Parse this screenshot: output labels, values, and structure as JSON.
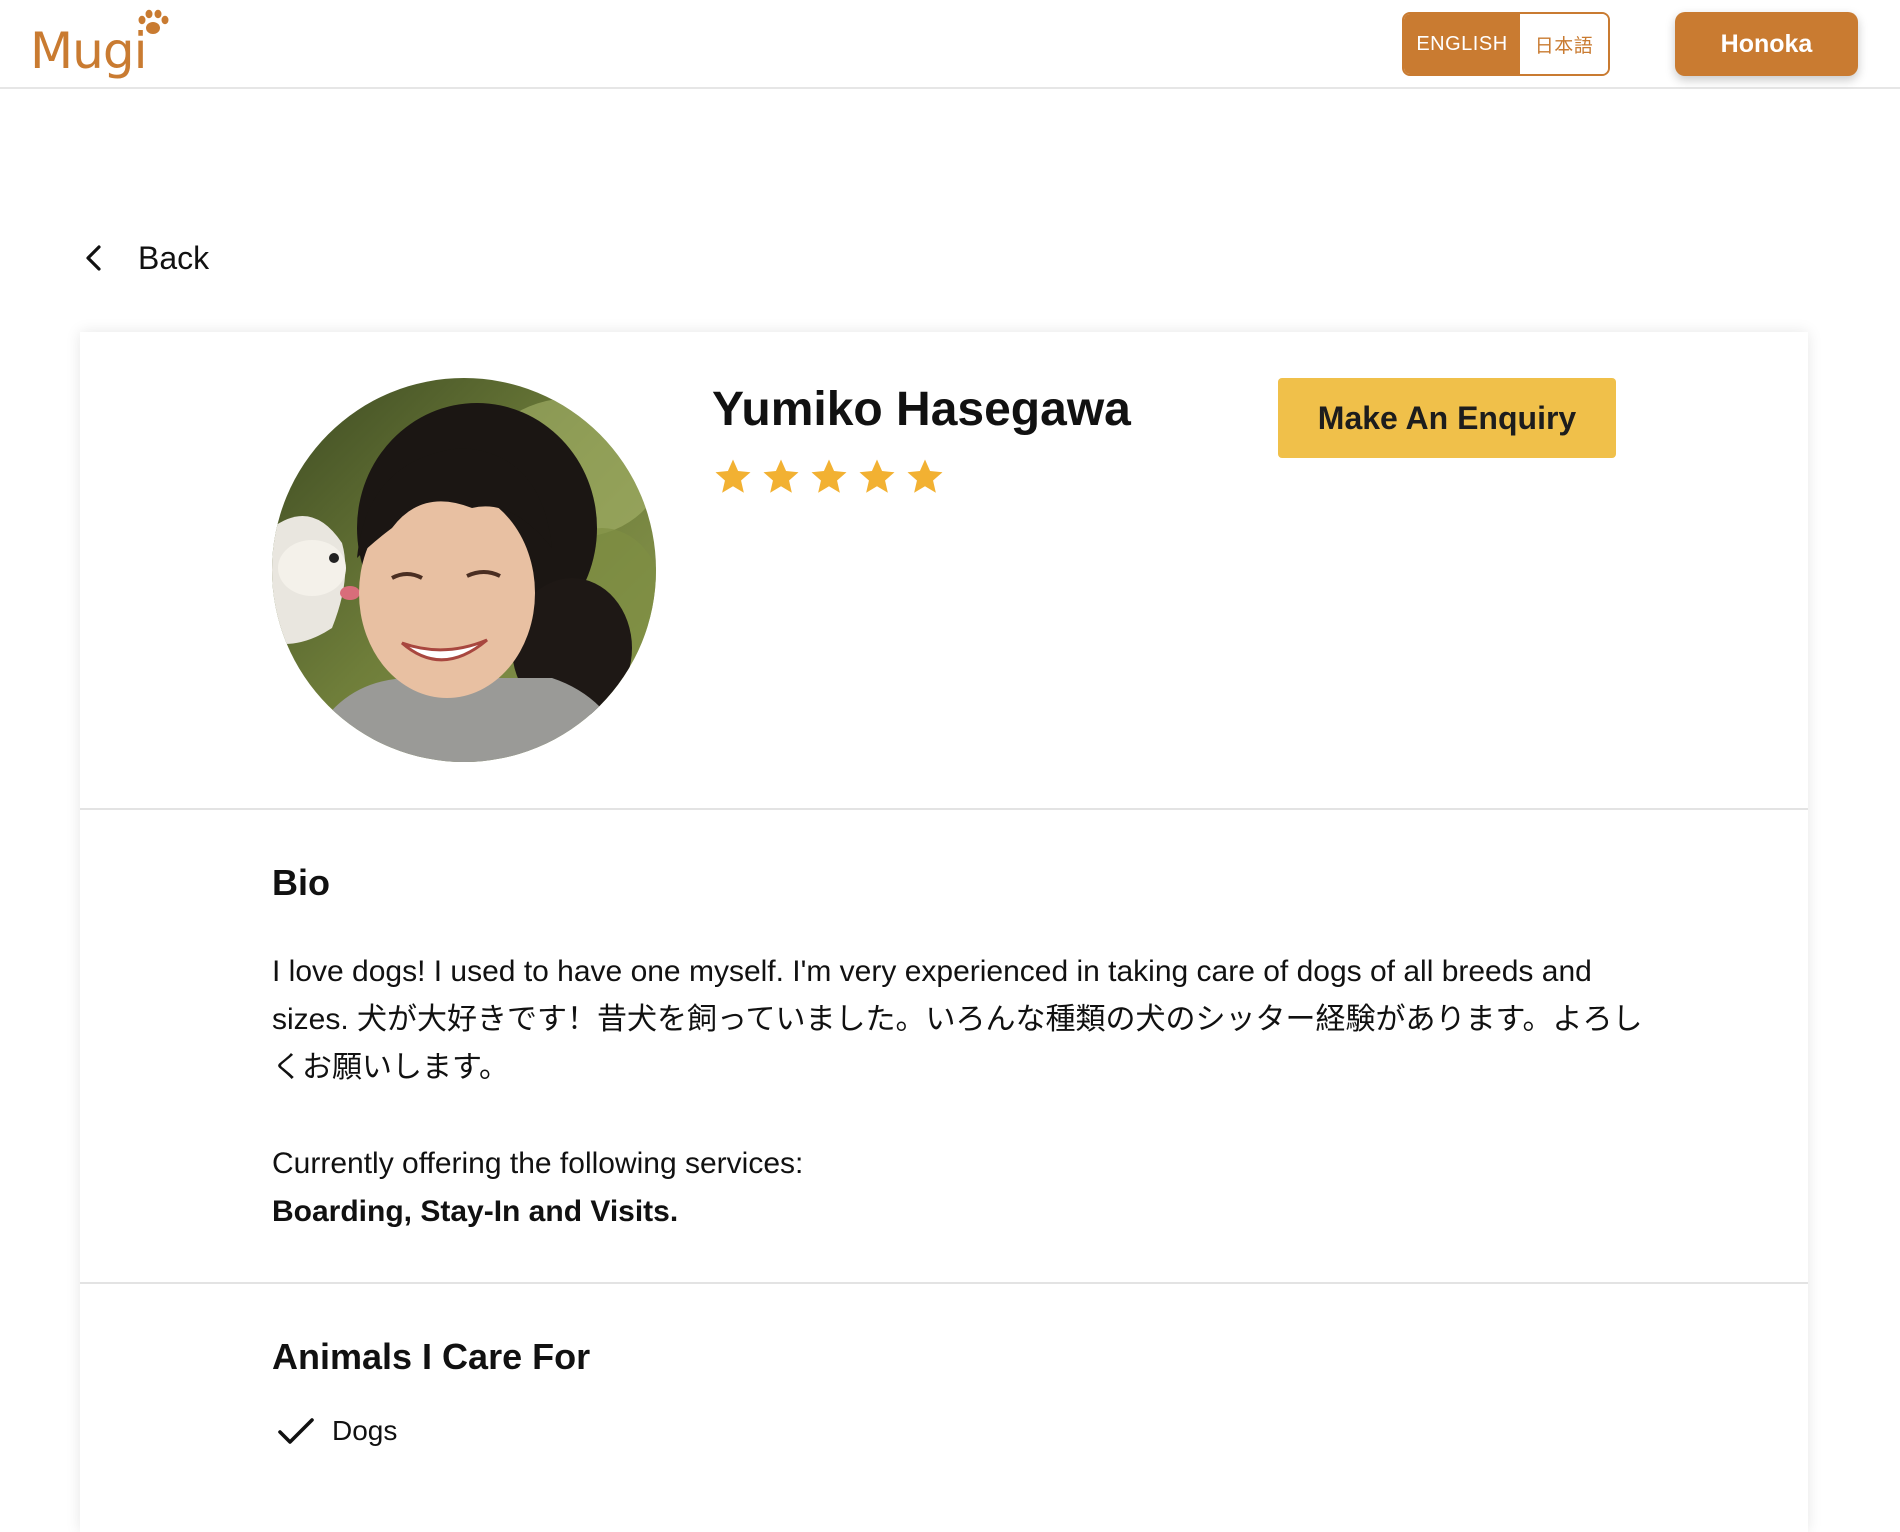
{
  "header": {
    "logo_text": "Mugi",
    "language": {
      "english_label": "ENGLISH",
      "japanese_label": "日本語",
      "selected": "ENGLISH"
    },
    "user_label": "Honoka"
  },
  "nav": {
    "back_label": "Back"
  },
  "profile": {
    "name": "Yumiko Hasegawa",
    "rating": 5,
    "rating_max": 5,
    "enquiry_label": "Make An Enquiry"
  },
  "bio": {
    "title": "Bio",
    "text": "I love dogs! I used to have one myself. I'm very experienced in taking care of dogs of all breeds and sizes. 犬が大好きです！昔犬を飼っていました。いろんな種類の犬のシッター経験があります。よろしくお願いします。",
    "services_label": "Currently offering the following services:",
    "services_value": "Boarding, Stay-In and Visits."
  },
  "animals": {
    "title": "Animals I Care For",
    "items": [
      "Dogs"
    ]
  },
  "colors": {
    "brand": "#c97b31",
    "accent": "#f0c04a",
    "star": "#f2b132"
  },
  "icons": {
    "back": "chevron-left-icon",
    "rating": "star-icon",
    "check": "check-icon",
    "logo_paw": "paw-icon"
  }
}
